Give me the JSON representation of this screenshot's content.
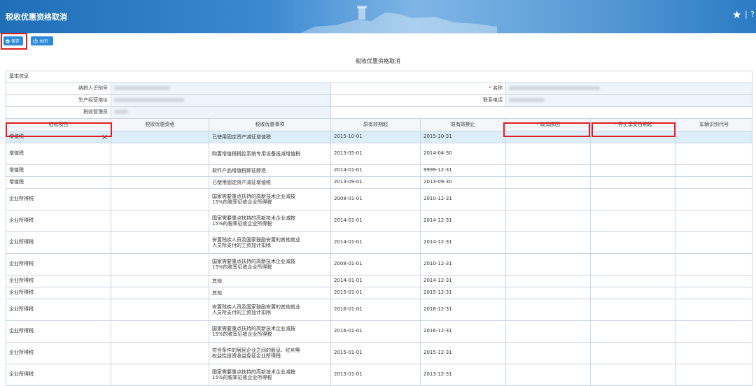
{
  "header": {
    "title": "税收优惠资格取消"
  },
  "toolbar": {
    "save_label": "保存",
    "close_label": "关闭"
  },
  "form": {
    "title": "税收优惠资格取消",
    "section_basic": "基本信息",
    "fields": {
      "taxpayer_id_label": "纳税人识别号",
      "name_label": "名称",
      "address_label": "生产经营地址",
      "phone_label": "联系电话",
      "tax_office_label": "税收管理员"
    }
  },
  "table": {
    "columns": [
      "征收项目",
      "税收优惠资格",
      "税收优惠事项",
      "原有效期起",
      "原有效期止",
      "取消原因",
      "停止享受日期起",
      "车辆识别代号"
    ],
    "required_columns": [
      5,
      6
    ],
    "rows": [
      {
        "item": "增值税",
        "matter": "已使用固定资产减征增值税",
        "start": "2015-10-01",
        "end": "2015-10-31",
        "selected": true
      },
      {
        "item": "增值税",
        "matter": "购置增值税税控系统专用设备抵减增值税",
        "start": "2013-05-01",
        "end": "2014-04-30"
      },
      {
        "item": "增值税",
        "matter": "软件产品增值税即征即退",
        "start": "2014-01-01",
        "end": "9999-12-31"
      },
      {
        "item": "增值税",
        "matter": "已使用固定资产减征增值税",
        "start": "2013-09-01",
        "end": "2013-09-30"
      },
      {
        "item": "企业所得税",
        "matter": "国家需要重点扶持的高新技术企业减按15%的税率征收企业所得税",
        "start": "2008-01-01",
        "end": "2010-12-31"
      },
      {
        "item": "企业所得税",
        "matter": "国家需要重点扶持的高新技术企业减按15%的税率征收企业所得税",
        "start": "2014-01-01",
        "end": "2014-12-31"
      },
      {
        "item": "企业所得税",
        "matter": "安置残疾人员及国家鼓励安置的其他就业人员所支付的工资加计扣除",
        "start": "2014-01-01",
        "end": "2014-12-31"
      },
      {
        "item": "企业所得税",
        "matter": "国家需要重点扶持的高新技术企业减按15%的税率征收企业所得税",
        "start": "2008-01-01",
        "end": "2010-12-31"
      },
      {
        "item": "企业所得税",
        "matter": "其他",
        "start": "2014-01-01",
        "end": "2014-12-31"
      },
      {
        "item": "企业所得税",
        "matter": "其他",
        "start": "2015-01-01",
        "end": "2015-12-31"
      },
      {
        "item": "企业所得税",
        "matter": "安置残疾人员及国家鼓励安置的其他就业人员所支付的工资加计扣除",
        "start": "2016-01-01",
        "end": "2016-12-31"
      },
      {
        "item": "企业所得税",
        "matter": "国家需要重点扶持的高新技术企业减按15%的税率征收企业所得税",
        "start": "2016-01-01",
        "end": "2016-12-31"
      },
      {
        "item": "企业所得税",
        "matter": "符合条件的居民企业之间的股息、红利等权益性投资收益免征企业所得税",
        "start": "2015-01-01",
        "end": "2015-12-31"
      },
      {
        "item": "企业所得税",
        "matter": "国家需要重点扶持的高新技术企业减按15%的税率征收企业所得税",
        "start": "2013-01-01",
        "end": "2013-12-31"
      }
    ]
  },
  "colors": {
    "accent": "#2d8bd8",
    "highlight": "#e02020",
    "selected_row": "#ddeefb"
  },
  "icons": {
    "header_star": "star-icon",
    "help": "help-icon",
    "save": "check-circle-icon",
    "close": "power-icon",
    "clear": "close-icon"
  }
}
